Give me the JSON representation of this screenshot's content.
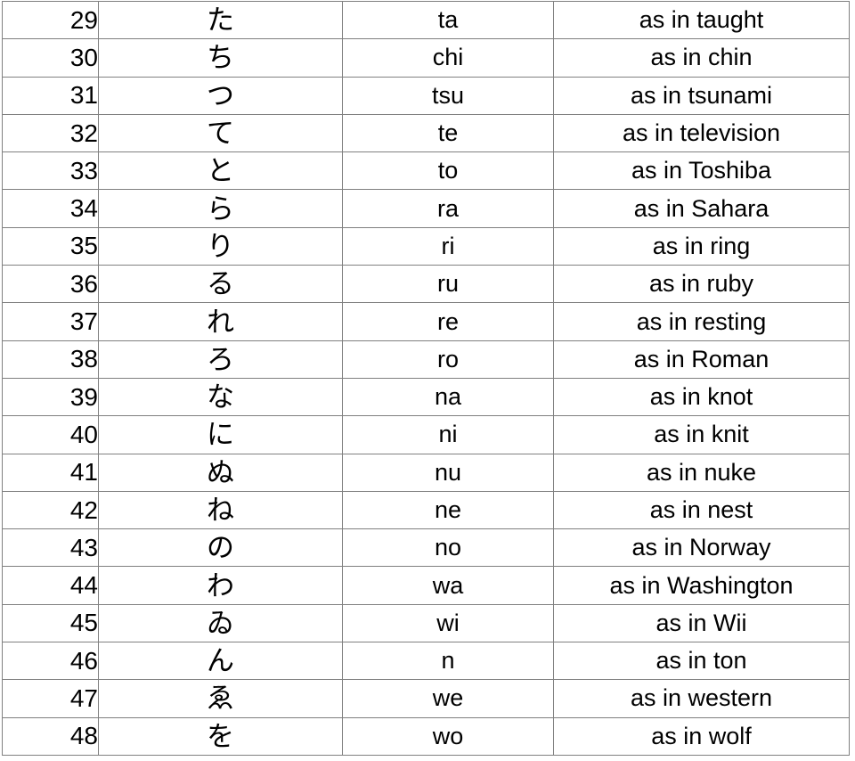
{
  "table": {
    "columns": [
      "index",
      "kana",
      "romaji",
      "example"
    ],
    "rows": [
      {
        "index": "29",
        "kana": "た",
        "romaji": "ta",
        "example": "as in taught"
      },
      {
        "index": "30",
        "kana": "ち",
        "romaji": "chi",
        "example": "as in chin"
      },
      {
        "index": "31",
        "kana": "つ",
        "romaji": "tsu",
        "example": "as in tsunami"
      },
      {
        "index": "32",
        "kana": "て",
        "romaji": "te",
        "example": "as in television"
      },
      {
        "index": "33",
        "kana": "と",
        "romaji": "to",
        "example": "as in Toshiba"
      },
      {
        "index": "34",
        "kana": "ら",
        "romaji": "ra",
        "example": "as in Sahara"
      },
      {
        "index": "35",
        "kana": "り",
        "romaji": "ri",
        "example": "as in ring"
      },
      {
        "index": "36",
        "kana": "る",
        "romaji": "ru",
        "example": "as in ruby"
      },
      {
        "index": "37",
        "kana": "れ",
        "romaji": "re",
        "example": "as in resting"
      },
      {
        "index": "38",
        "kana": "ろ",
        "romaji": "ro",
        "example": "as in Roman"
      },
      {
        "index": "39",
        "kana": "な",
        "romaji": "na",
        "example": "as in knot"
      },
      {
        "index": "40",
        "kana": "に",
        "romaji": "ni",
        "example": "as in knit"
      },
      {
        "index": "41",
        "kana": "ぬ",
        "romaji": "nu",
        "example": "as in nuke"
      },
      {
        "index": "42",
        "kana": "ね",
        "romaji": "ne",
        "example": "as in nest"
      },
      {
        "index": "43",
        "kana": "の",
        "romaji": "no",
        "example": "as in Norway"
      },
      {
        "index": "44",
        "kana": "わ",
        "romaji": "wa",
        "example": "as in Washington"
      },
      {
        "index": "45",
        "kana": "ゐ",
        "romaji": "wi",
        "example": "as in Wii"
      },
      {
        "index": "46",
        "kana": "ん",
        "romaji": "n",
        "example": "as in ton"
      },
      {
        "index": "47",
        "kana": "ゑ",
        "romaji": "we",
        "example": "as in western"
      },
      {
        "index": "48",
        "kana": "を",
        "romaji": "wo",
        "example": "as in wolf"
      }
    ]
  },
  "colors": {
    "grid_line": "#808080",
    "text": "#000000",
    "background": "#ffffff"
  }
}
